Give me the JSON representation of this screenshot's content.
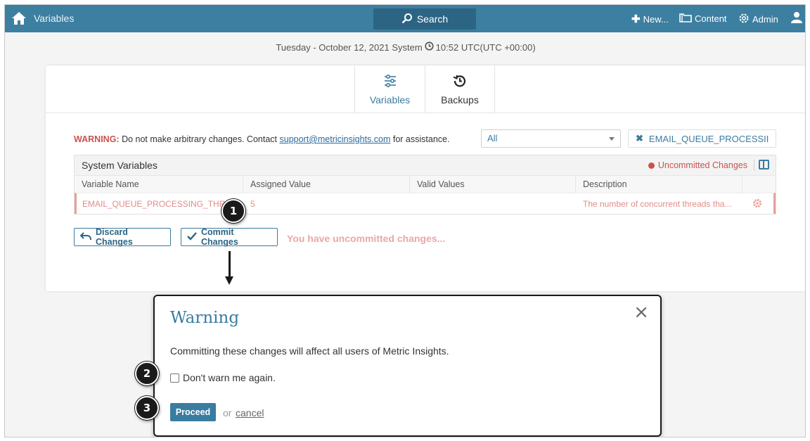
{
  "header": {
    "page_title": "Variables",
    "search_label": "Search",
    "nav": {
      "new_label": "New...",
      "content_label": "Content",
      "admin_label": "Admin"
    }
  },
  "datebar": {
    "date_text": "Tuesday - October 12, 2021 System",
    "time_text": "10:52 UTC(UTC +00:00)"
  },
  "tabs": [
    {
      "label": "Variables",
      "active": true
    },
    {
      "label": "Backups",
      "active": false
    }
  ],
  "warning": {
    "prefix": "WARNING:",
    "text": "Do not make arbitrary changes. Contact",
    "email": "support@metricinsights.com",
    "suffix": "for assistance."
  },
  "filter": {
    "select_value": "All",
    "chip_value": "EMAIL_QUEUE_PROCESSII"
  },
  "grid": {
    "title": "System Variables",
    "status": "Uncommitted Changes",
    "columns": [
      "Variable Name",
      "Assigned Value",
      "Valid Values",
      "Description"
    ],
    "rows": [
      {
        "name": "EMAIL_QUEUE_PROCESSING_THR",
        "value": "5",
        "valid": "",
        "description": "The number of concurrent threads tha..."
      }
    ]
  },
  "actions": {
    "discard_label": "Discard Changes",
    "commit_label": "Commit Changes",
    "uncommitted_msg": "You have uncommitted changes..."
  },
  "callouts": [
    "1",
    "2",
    "3"
  ],
  "dialog": {
    "title": "Warning",
    "close_glyph": "×",
    "message": "Committing these changes will affect all users of Metric Insights.",
    "checkbox_label": "Don't warn me again.",
    "proceed_label": "Proceed",
    "or_text": "or",
    "cancel_label": "cancel"
  },
  "colors": {
    "nav_bg": "#3d7fa0",
    "accent": "#3a7ca0",
    "warning": "#c9534f"
  }
}
